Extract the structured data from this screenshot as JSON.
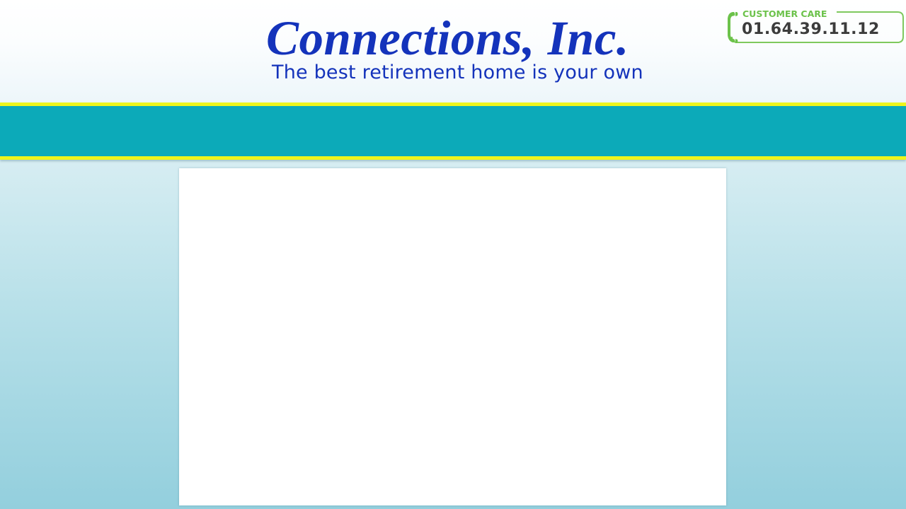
{
  "header": {
    "title": "Connections, Inc.",
    "tagline": "The best retirement home is your own"
  },
  "customer_care": {
    "label": "CUSTOMER CARE",
    "phone": "01.64.39.11.12",
    "icon": "phone-icon",
    "accent_color": "#6cc24a"
  },
  "colors": {
    "brand_blue": "#1433bb",
    "nav_teal": "#0caab9",
    "nav_border_yellow": "#eef51c",
    "background_light": "#dff0f5",
    "background_dark": "#93cfdd"
  }
}
